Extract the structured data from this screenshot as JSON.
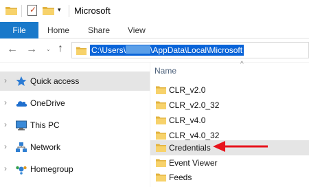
{
  "titlebar": {
    "title": "Microsoft",
    "dropdown_glyph": "▾",
    "checkmark_glyph": "✓",
    "icons": [
      "folder-icon",
      "properties-icon",
      "new-folder-icon"
    ]
  },
  "ribbon": {
    "tabs": [
      "File",
      "Home",
      "Share",
      "View"
    ]
  },
  "addressbar": {
    "back_glyph": "←",
    "forward_glyph": "→",
    "recent_glyph": "⌄",
    "up_glyph": "↑",
    "path_prefix": "C:\\Users\\",
    "path_suffix": "\\AppData\\Local\\Microsoft"
  },
  "navpane": {
    "items": [
      {
        "label": "Quick access",
        "icon": "star-icon"
      },
      {
        "label": "OneDrive",
        "icon": "cloud-icon"
      },
      {
        "label": "This PC",
        "icon": "computer-icon"
      },
      {
        "label": "Network",
        "icon": "network-icon"
      },
      {
        "label": "Homegroup",
        "icon": "homegroup-icon"
      }
    ],
    "chevron_glyph": "›"
  },
  "filepane": {
    "column_header": "Name",
    "sort_glyph": "^",
    "files": [
      "CLR_v2.0",
      "CLR_v2.0_32",
      "CLR_v4.0",
      "CLR_v4.0_32",
      "Credentials",
      "Event Viewer",
      "Feeds"
    ]
  },
  "annotation": {
    "arrow_color": "#e8141c",
    "points_to": "Credentials"
  },
  "colors": {
    "accent": "#1979ca",
    "selection": "#0a64d8",
    "folder": "#f7d26b",
    "highlight_row": "#e5e5e5"
  }
}
